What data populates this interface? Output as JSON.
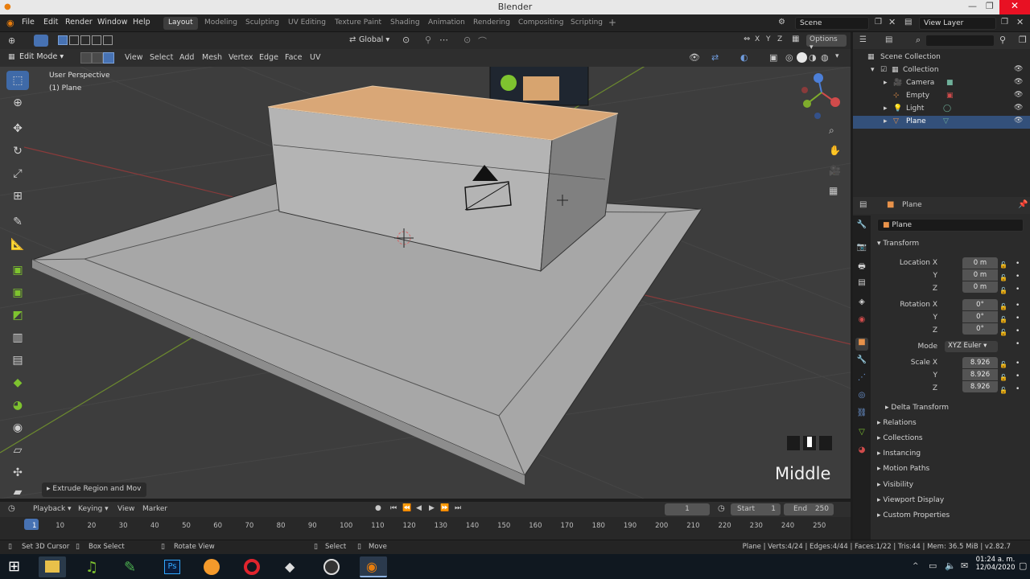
{
  "title": "Blender",
  "menu": [
    "File",
    "Edit",
    "Render",
    "Window",
    "Help"
  ],
  "workspaces": [
    "Layout",
    "Modeling",
    "Sculpting",
    "UV Editing",
    "Texture Paint",
    "Shading",
    "Animation",
    "Rendering",
    "Compositing",
    "Scripting"
  ],
  "active_workspace": "Layout",
  "scene": "Scene",
  "view_layer": "View Layer",
  "vp_header": {
    "mode": "Edit Mode",
    "menus": [
      "View",
      "Select",
      "Add",
      "Mesh",
      "Vertex",
      "Edge",
      "Face",
      "UV"
    ],
    "transform_orientation": "Global",
    "options": "Options"
  },
  "viewport": {
    "perspective": "User Perspective",
    "object": "(1) Plane",
    "overlay_text": "Middle",
    "last_op": "Extrude Region and Mov"
  },
  "outliner": {
    "root": "Scene Collection",
    "collection": "Collection",
    "items": [
      "Camera",
      "Empty",
      "Light",
      "Plane"
    ],
    "selected": "Plane"
  },
  "properties": {
    "object_header": "Plane",
    "object_name": "Plane",
    "transform_panel": "Transform",
    "location_label": "Location X",
    "location": [
      "0 m",
      "0 m",
      "0 m"
    ],
    "rotation_label": "Rotation X",
    "rotation": [
      "0°",
      "0°",
      "0°"
    ],
    "mode_label": "Mode",
    "rotation_mode": "XYZ Euler",
    "scale_label": "Scale X",
    "scale": [
      "8.926",
      "8.926",
      "8.926"
    ],
    "axis_y": "Y",
    "axis_z": "Z",
    "subpanels": [
      "Delta Transform",
      "Relations",
      "Collections",
      "Instancing",
      "Motion Paths",
      "Visibility",
      "Viewport Display",
      "Custom Properties"
    ]
  },
  "timeline": {
    "menus": [
      "Playback",
      "Keying",
      "View",
      "Marker"
    ],
    "current_frame": "1",
    "start_label": "Start",
    "start": "1",
    "end_label": "End",
    "end": "250",
    "ticks": [
      "1",
      "10",
      "20",
      "30",
      "40",
      "50",
      "60",
      "70",
      "80",
      "90",
      "100",
      "110",
      "120",
      "130",
      "140",
      "150",
      "160",
      "170",
      "180",
      "190",
      "200",
      "210",
      "220",
      "230",
      "240",
      "250"
    ]
  },
  "status": {
    "left": [
      "Set 3D Cursor",
      "Box Select",
      "Rotate View",
      "Select",
      "Move"
    ],
    "right": "Plane | Verts:4/24 | Edges:4/44 | Faces:1/22 | Tris:44 | Mem: 36.5 MiB | v2.82.7"
  },
  "taskbar": {
    "time": "01:24 a. m.",
    "date": "12/04/2020"
  },
  "colors": {
    "accent_blue": "#4772b3",
    "selected_face": "#d9a777",
    "mesh_gray": "#b9b9b9"
  }
}
